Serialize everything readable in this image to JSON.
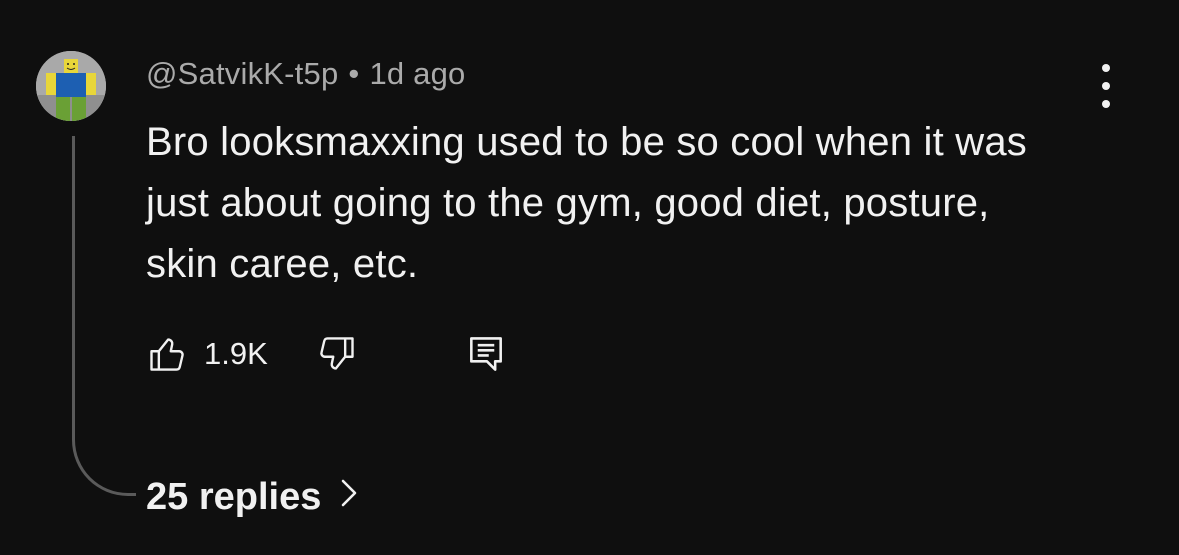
{
  "comment": {
    "author": "@SatvikK-t5p",
    "separator": "•",
    "time_ago": "1d ago",
    "text_lines": [
      "Bro looksmaxxing used to be so cool when it was",
      "just about going to the gym, good diet, posture,",
      "skin caree, etc."
    ],
    "like_count": "1.9K",
    "replies_label": "25 replies",
    "icons": {
      "avatar": "roblox-noob-avatar",
      "like": "thumbs-up-icon",
      "dislike": "thumbs-down-icon",
      "reply": "comment-reply-icon",
      "menu": "more-vertical-icon",
      "replies": "chevron-right-icon"
    }
  },
  "colors": {
    "background": "#0f0f0f",
    "text_primary": "#f1f1f1",
    "text_secondary": "#aaaaaa",
    "thread_line": "#5a5a5a"
  }
}
